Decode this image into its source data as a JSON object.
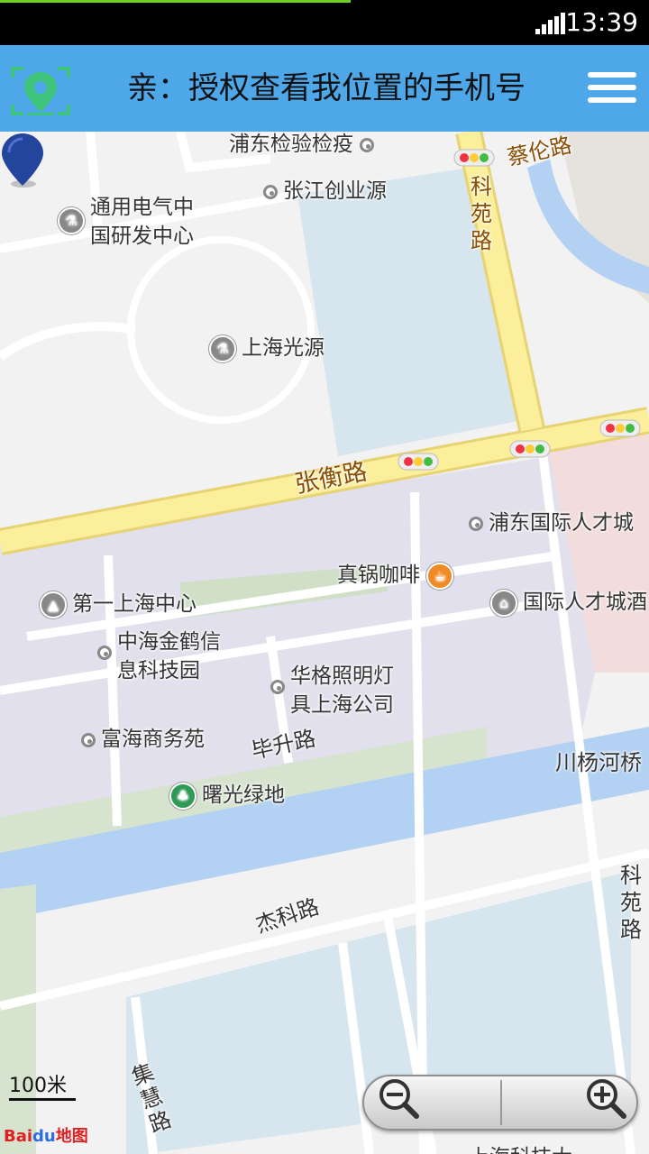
{
  "status_bar": {
    "time": "13:39",
    "progress_percent": 54
  },
  "app_bar": {
    "title": "亲：授权查看我位置的手机号"
  },
  "map": {
    "roads": {
      "zhangheng": "张衡路",
      "keyuan_top": "科苑路",
      "keyuan_bottom": "科苑路",
      "cailun": "蔡伦路",
      "bisheng": "毕升路",
      "jieke": "杰科路",
      "jihui": "集慧路",
      "chuanyanghe": "川杨河桥"
    },
    "pois": {
      "pudong_inspection": "浦东检验检疫",
      "zhangjiang_startup": "张江创业源",
      "ge_center": "通用电气中\n国研发中心",
      "shanghai_light_source": "上海光源",
      "pudong_talent": "浦东国际人才城",
      "coffee": "真锅咖啡",
      "first_shanghai_center": "第一上海中心",
      "talent_city": "国际人才城酒",
      "zhonghai_jinhe": "中海金鹤信\n息科技园",
      "huage_lighting": "华格照明灯\n具上海公司",
      "fuhai": "富海商务苑",
      "shuguang_green": "曙光绿地",
      "bottom_partial": "上海科技大"
    },
    "scale_label": "100米",
    "logo_text": {
      "brand": "Bai",
      "du": "du",
      "suffix": "地图"
    }
  }
}
